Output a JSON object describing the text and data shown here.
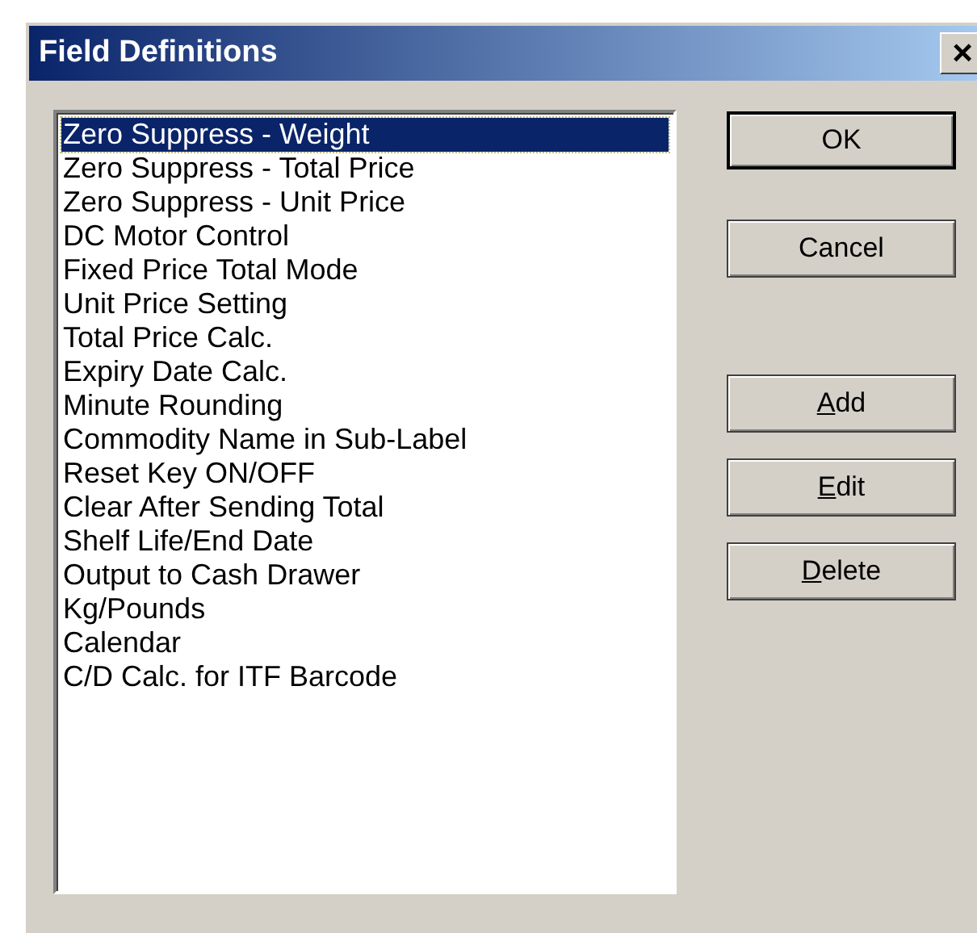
{
  "window": {
    "title": "Field Definitions",
    "close": "×"
  },
  "list": {
    "items": [
      {
        "label": "Zero Suppress - Weight",
        "selected": true
      },
      {
        "label": "Zero Suppress - Total Price",
        "selected": false
      },
      {
        "label": "Zero Suppress - Unit Price",
        "selected": false
      },
      {
        "label": "DC Motor Control",
        "selected": false
      },
      {
        "label": "Fixed Price Total Mode",
        "selected": false
      },
      {
        "label": "Unit Price Setting",
        "selected": false
      },
      {
        "label": "Total Price Calc.",
        "selected": false
      },
      {
        "label": "Expiry Date Calc.",
        "selected": false
      },
      {
        "label": "Minute Rounding",
        "selected": false
      },
      {
        "label": "Commodity Name in Sub-Label",
        "selected": false
      },
      {
        "label": "Reset Key ON/OFF",
        "selected": false
      },
      {
        "label": "Clear After Sending Total",
        "selected": false
      },
      {
        "label": "Shelf Life/End Date",
        "selected": false
      },
      {
        "label": "Output to Cash Drawer",
        "selected": false
      },
      {
        "label": "Kg/Pounds",
        "selected": false
      },
      {
        "label": "Calendar",
        "selected": false
      },
      {
        "label": "C/D Calc. for ITF Barcode",
        "selected": false
      }
    ]
  },
  "dialog_buttons": [
    {
      "label": "OK",
      "default": true,
      "underline_first": false
    },
    {
      "label": "Cancel",
      "default": false,
      "underline_first": false
    }
  ],
  "list_buttons": [
    {
      "label": "Add",
      "default": false,
      "underline_first": true
    },
    {
      "label": "Edit",
      "default": false,
      "underline_first": true
    },
    {
      "label": "Delete",
      "default": false,
      "underline_first": true
    }
  ]
}
